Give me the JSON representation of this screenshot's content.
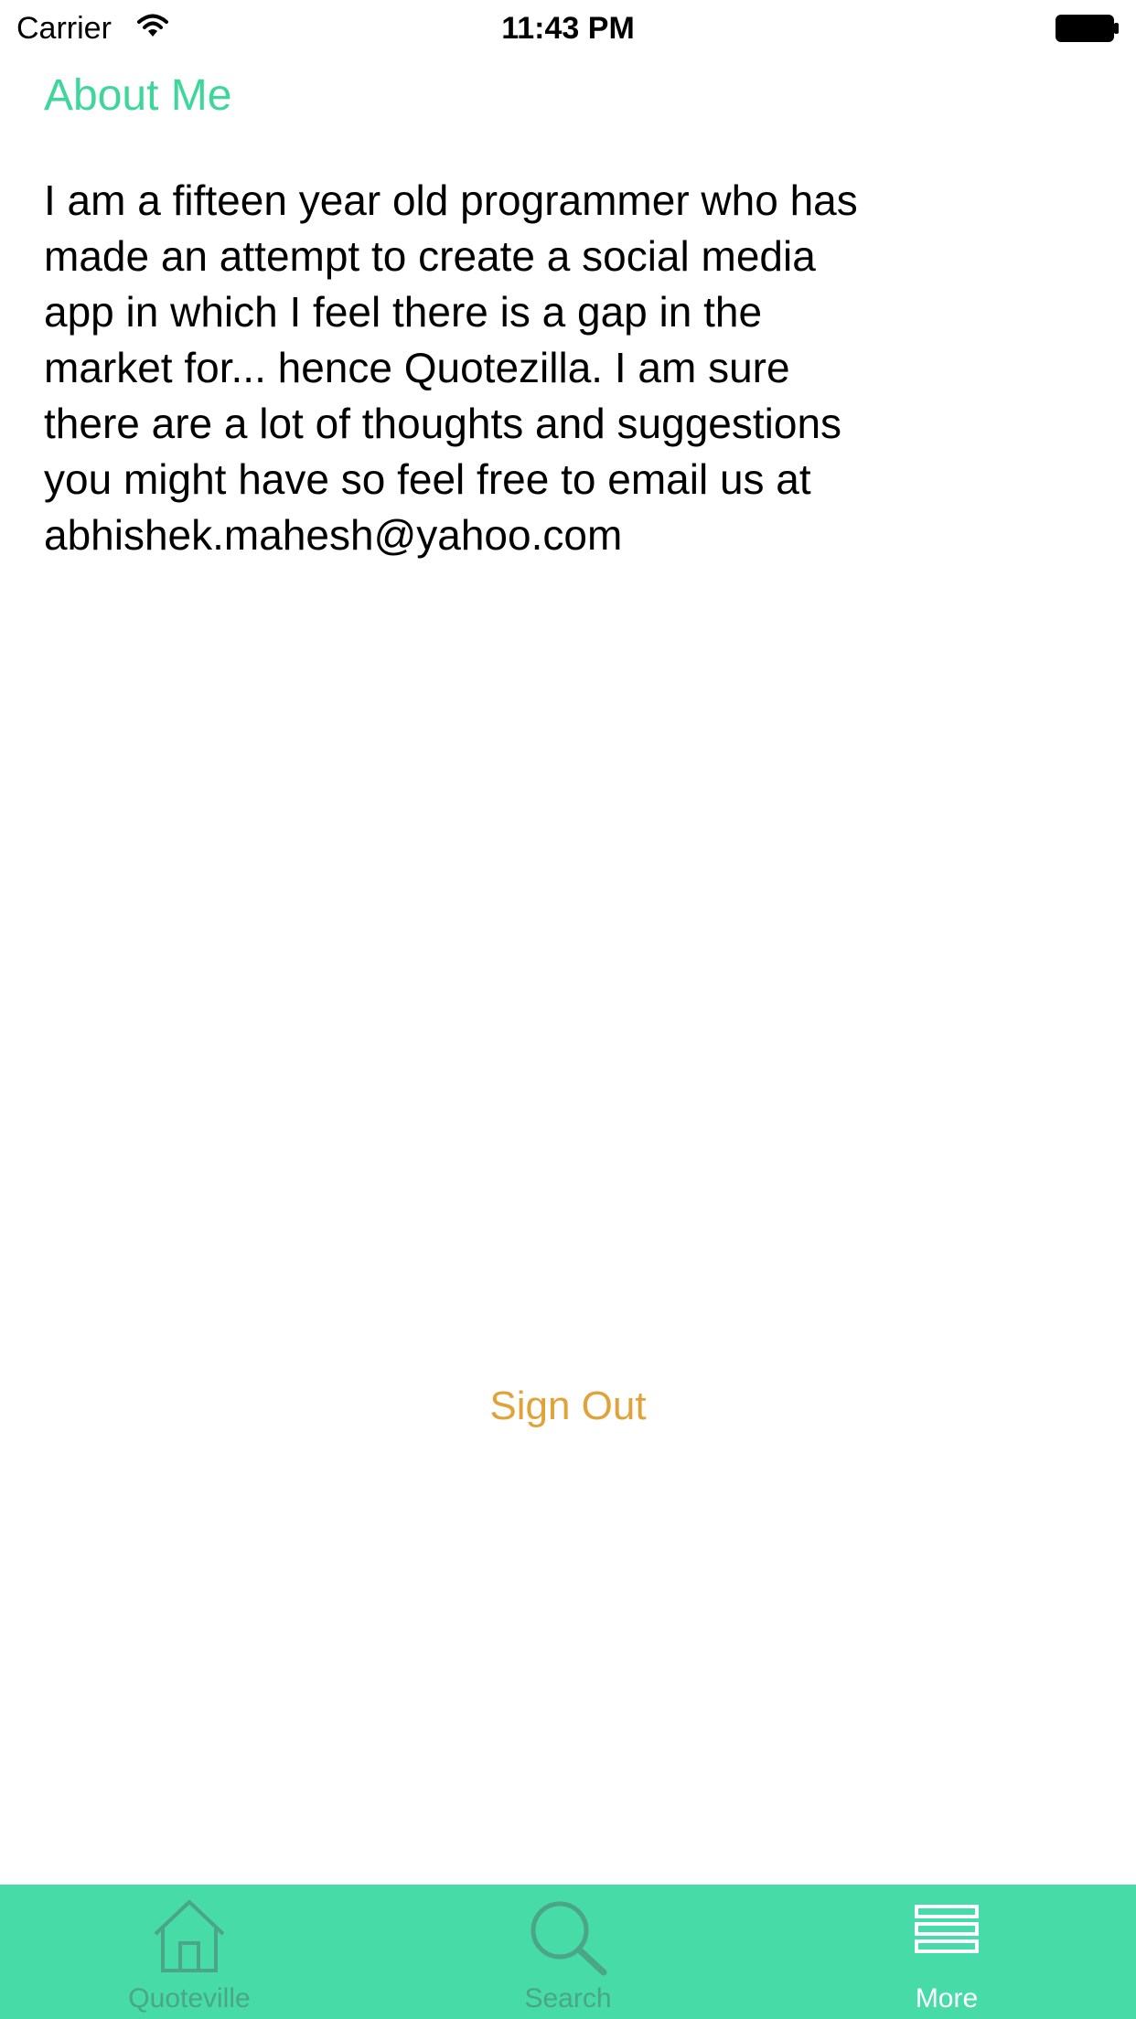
{
  "status_bar": {
    "carrier": "Carrier",
    "time": "11:43 PM",
    "icons": [
      "wifi-icon",
      "battery-icon"
    ]
  },
  "about": {
    "title": "About Me",
    "text": "I am a fifteen year old programmer who has made an attempt to create a social media app in which I feel there is a gap in the market for... hence Quotezilla. I am sure there are a lot of thoughts and suggestions you might have so feel free to email us at abhishek.mahesh@yahoo.com"
  },
  "actions": {
    "sign_out": "Sign Out"
  },
  "tab_bar": {
    "tabs": [
      {
        "label": "Quoteville",
        "icon": "home-icon",
        "active": false
      },
      {
        "label": "Search",
        "icon": "search-icon",
        "active": false
      },
      {
        "label": "More",
        "icon": "more-icon",
        "active": true
      }
    ]
  },
  "colors": {
    "accent": "#3ed69a",
    "tab_bar_background": "#47dba7",
    "sign_out": "#e0a33a",
    "tab_inactive": "#4aa686",
    "tab_active": "#ffffff"
  }
}
